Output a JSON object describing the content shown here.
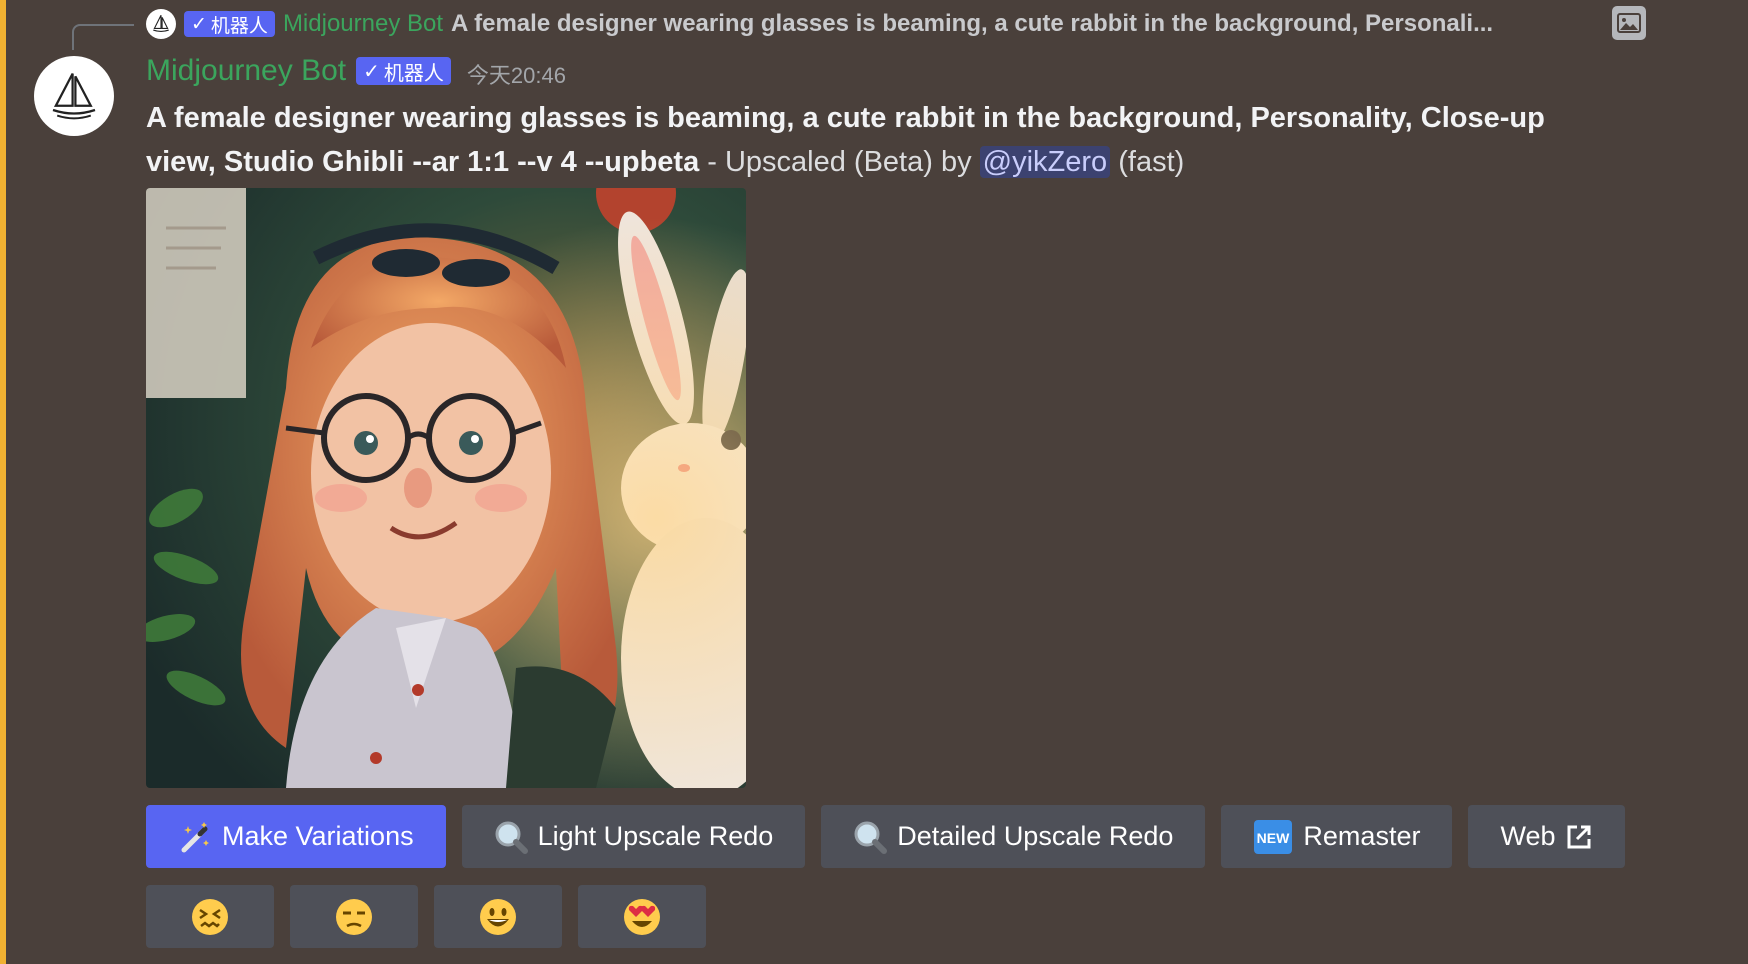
{
  "reply": {
    "author": "Midjourney Bot",
    "badge": "机器人",
    "text": "A female designer wearing glasses is beaming, a cute rabbit in the background, Personali..."
  },
  "message": {
    "author": "Midjourney Bot",
    "badge": "机器人",
    "timestamp": "今天20:46",
    "prompt": "A female designer wearing glasses is beaming, a cute rabbit in the background, Personality, Close-up view, Studio Ghibli --ar 1:1 --v 4 --upbeta",
    "suffix_pre": " - Upscaled (Beta) by ",
    "mention": "@yikZero",
    "suffix_post": " (fast)"
  },
  "buttons": [
    {
      "label": "Make Variations",
      "icon": "magic-wand-icon"
    },
    {
      "label": "Light Upscale Redo",
      "icon": "magnifier-icon"
    },
    {
      "label": "Detailed Upscale Redo",
      "icon": "magnifier-icon"
    },
    {
      "label": "Remaster",
      "icon": "new-badge-icon"
    },
    {
      "label": "Web",
      "icon": "external-link-icon"
    }
  ],
  "reactions": [
    "confounded-face-icon",
    "unamused-face-icon",
    "grinning-face-icon",
    "heart-eyes-face-icon"
  ],
  "colors": {
    "brand": "#5865f2",
    "author": "#3ba55d",
    "background": "#4a403b"
  }
}
